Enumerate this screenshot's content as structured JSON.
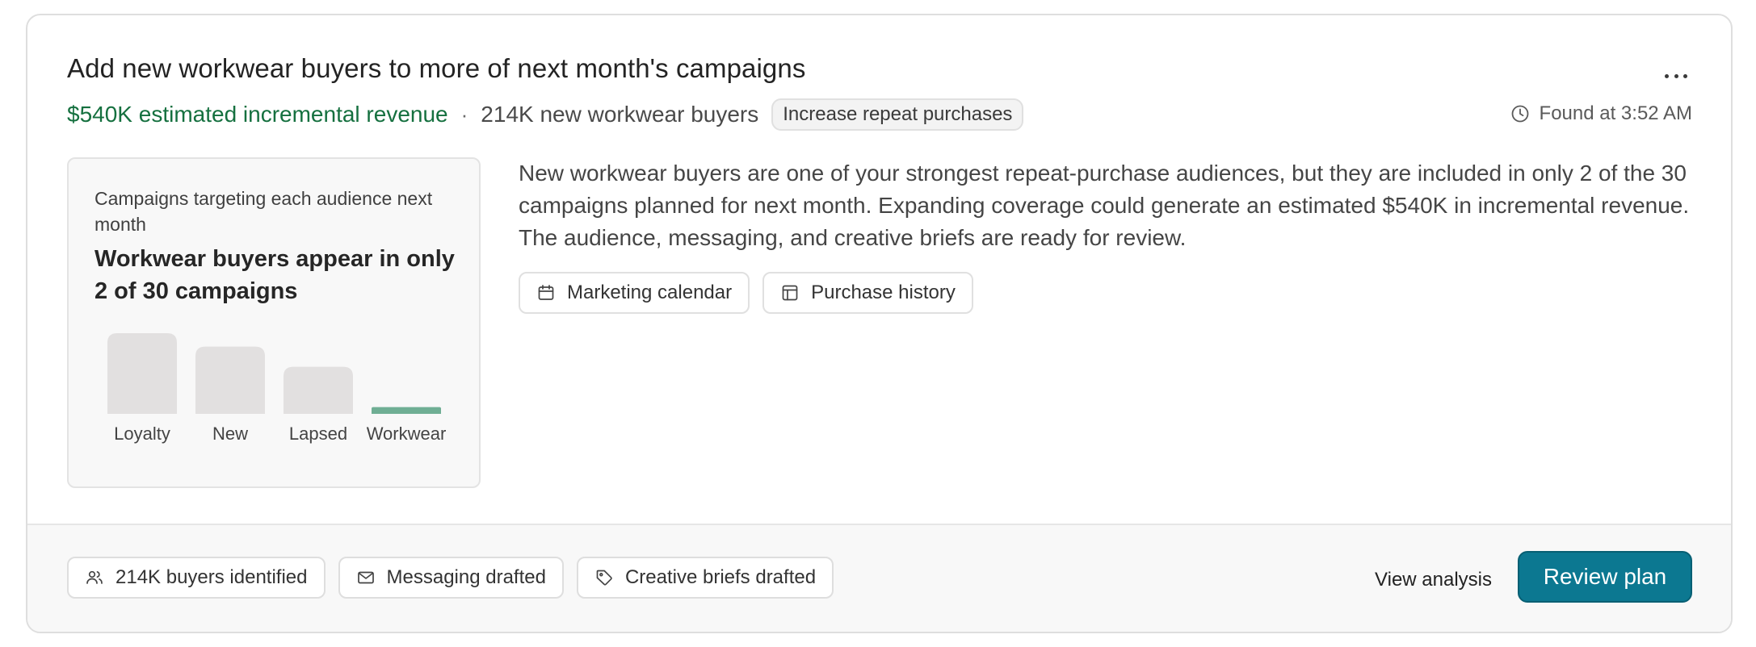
{
  "card": {
    "title": "Add new workwear buyers to more of next month's campaigns",
    "revenue": "$540K estimated incremental revenue",
    "separator": "·",
    "buyers": "214K new workwear buyers",
    "goal_tag": "Increase repeat purchases",
    "found_at": "Found at 3:52 AM",
    "more_icon": "more-horizontal-icon",
    "clock_icon": "clock-icon"
  },
  "chart_panel": {
    "subtitle": "Campaigns targeting each audience next month",
    "headline": "Workwear buyers appear in only 2 of 30 campaigns"
  },
  "chart_data": {
    "type": "bar",
    "categories": [
      "Loyalty",
      "New",
      "Lapsed",
      "Workwear"
    ],
    "values": [
      12,
      10,
      7,
      1
    ],
    "highlight": "Workwear",
    "colors": {
      "bar": "#e2e0e0",
      "highlight": "#6fae94"
    },
    "grid": false
  },
  "description": "New workwear buyers are one of your strongest repeat-purchase audiences, but they are included in only 2 of the 30 campaigns planned for next month. Expanding coverage could generate an estimated $540K in incremental revenue. The audience, messaging, and creative briefs are ready for review.",
  "sources": [
    {
      "label": "Marketing calendar",
      "icon": "calendar-icon"
    },
    {
      "label": "Purchase history",
      "icon": "table-icon"
    }
  ],
  "footer": {
    "statuses": [
      {
        "label": "214K buyers identified",
        "icon": "users-icon"
      },
      {
        "label": "Messaging drafted",
        "icon": "mail-icon"
      },
      {
        "label": "Creative briefs drafted",
        "icon": "tag-icon"
      }
    ],
    "view_analysis": "View analysis",
    "review_plan": "Review plan"
  },
  "colors": {
    "revenue": "#15703f",
    "primary_button": "#0c7891",
    "footer_bg": "#f8f8f8"
  }
}
